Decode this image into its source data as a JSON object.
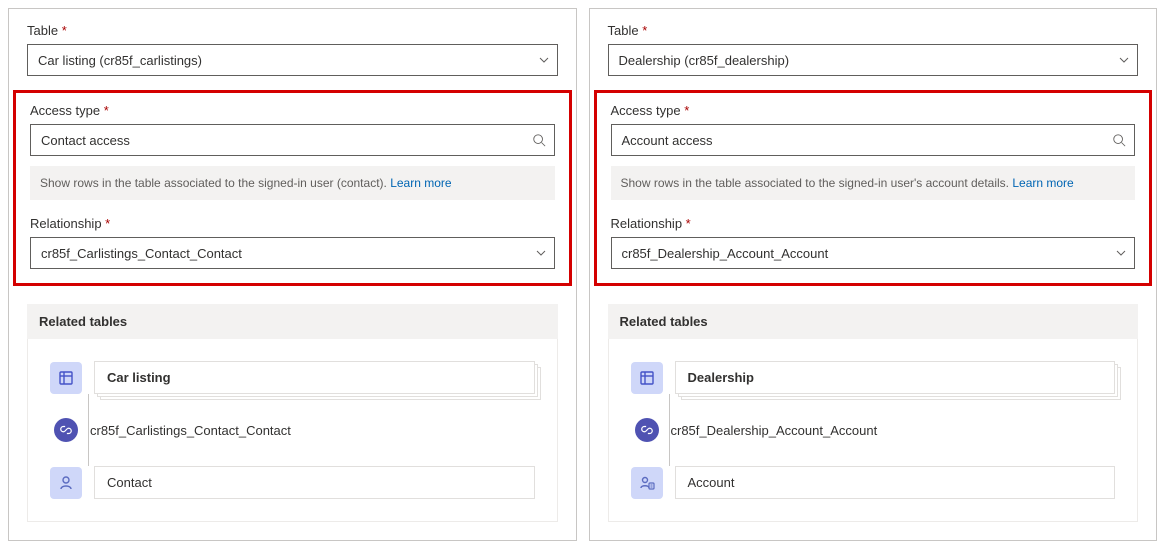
{
  "left": {
    "table_label": "Table",
    "table_value": "Car listing (cr85f_carlistings)",
    "access_label": "Access type",
    "access_value": "Contact access",
    "helper_text": "Show rows in the table associated to the signed-in user (contact). ",
    "learn_more": "Learn more",
    "relationship_label": "Relationship",
    "relationship_value": "cr85f_Carlistings_Contact_Contact",
    "related_header": "Related tables",
    "related_top": "Car listing",
    "related_link": "cr85f_Carlistings_Contact_Contact",
    "related_bottom": "Contact"
  },
  "right": {
    "table_label": "Table",
    "table_value": "Dealership (cr85f_dealership)",
    "access_label": "Access type",
    "access_value": "Account access",
    "helper_text": "Show rows in the table associated to the signed-in user's account details. ",
    "learn_more": "Learn more",
    "relationship_label": "Relationship",
    "relationship_value": "cr85f_Dealership_Account_Account",
    "related_header": "Related tables",
    "related_top": "Dealership",
    "related_link": "cr85f_Dealership_Account_Account",
    "related_bottom": "Account"
  }
}
